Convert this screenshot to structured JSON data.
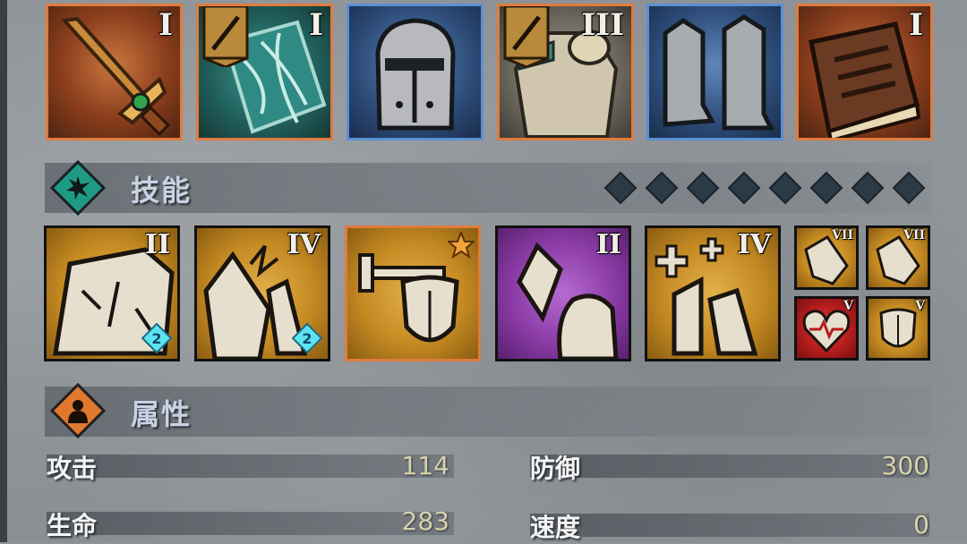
{
  "equipment": [
    {
      "roman": "I",
      "rarity": "orange",
      "icon": "sword-icon",
      "banner": false
    },
    {
      "roman": "I",
      "rarity": "orange",
      "icon": "ornate-shield-icon",
      "banner": true
    },
    {
      "roman": "",
      "rarity": "blue",
      "icon": "helmet-icon",
      "banner": false
    },
    {
      "roman": "III",
      "rarity": "orange",
      "icon": "plate-armor-icon",
      "banner": true
    },
    {
      "roman": "",
      "rarity": "blue",
      "icon": "greaves-icon",
      "banner": false
    },
    {
      "roman": "I",
      "rarity": "orange",
      "icon": "book-icon",
      "banner": false
    }
  ],
  "skills_section": {
    "title": "技能",
    "pip_count": 8
  },
  "skills": [
    {
      "roman": "II",
      "color": "gold",
      "icon": "stone-wall-icon",
      "gem": "2",
      "selected": false
    },
    {
      "roman": "IV",
      "color": "gold",
      "icon": "shattered-armor-icon",
      "gem": "2",
      "selected": false
    },
    {
      "roman": "",
      "color": "gold",
      "icon": "dumbbell-shield-icon",
      "gem": "",
      "selected": true
    },
    {
      "roman": "II",
      "color": "purple",
      "icon": "crystal-flex-icon",
      "gem": "",
      "selected": false
    },
    {
      "roman": "IV",
      "color": "gold",
      "icon": "heal-armor-icon",
      "gem": "",
      "selected": false
    }
  ],
  "small_skills": [
    {
      "roman": "VII",
      "color": "gold",
      "icon": "cracked-armor-icon"
    },
    {
      "roman": "VII",
      "color": "gold",
      "icon": "cracked-armor-icon"
    },
    {
      "roman": "V",
      "color": "red",
      "icon": "heart-pulse-icon"
    },
    {
      "roman": "V",
      "color": "gold",
      "icon": "shield-icon"
    }
  ],
  "attributes_section": {
    "title": "属性"
  },
  "stats": {
    "attack": {
      "label": "攻击",
      "value": "114"
    },
    "defense": {
      "label": "防御",
      "value": "300"
    },
    "hp": {
      "label": "生命",
      "value": "283"
    },
    "speed": {
      "label": "速度",
      "value": "0"
    }
  },
  "colors": {
    "orange_border": "#e07b3c",
    "blue_border": "#5d8fd0",
    "teal_badge": "#1f9a85",
    "orange_badge": "#e0782e"
  }
}
